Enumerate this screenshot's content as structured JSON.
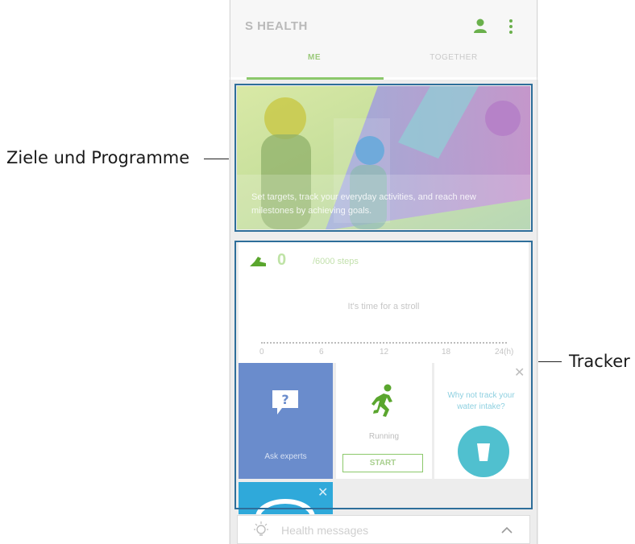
{
  "callouts": {
    "goals": "Ziele und Programme",
    "tracker": "Tracker"
  },
  "app": {
    "title": "S HEALTH",
    "icons": {
      "profile": "person-icon",
      "more": "more-vert-icon"
    },
    "tabs": [
      {
        "label": "ME",
        "active": true
      },
      {
        "label": "TOGETHER",
        "active": false
      }
    ],
    "accent_color": "#8cc86b"
  },
  "goals_card": {
    "caption": "Set targets, track your everyday activities, and reach new milestones by achieving goals."
  },
  "steps_card": {
    "value": "0",
    "unit": "/6000 steps",
    "message": "It's time for a stroll",
    "timeline_ticks": [
      "0",
      "6",
      "12",
      "18",
      "24(h)"
    ],
    "icon": "shoe-icon"
  },
  "tiles": {
    "ask_experts": {
      "label": "Ask experts",
      "icon": "question-bubble-icon",
      "color": "#6a8ccc"
    },
    "running": {
      "label": "Running",
      "button": "START",
      "icon": "runner-icon"
    },
    "water": {
      "text": "Why not track your water intake?",
      "icon": "cup-icon",
      "color": "#50c0cf"
    }
  },
  "health_messages": {
    "label": "Health messages",
    "icon": "lightbulb-icon"
  },
  "highlight_color": "#2e6e9a"
}
